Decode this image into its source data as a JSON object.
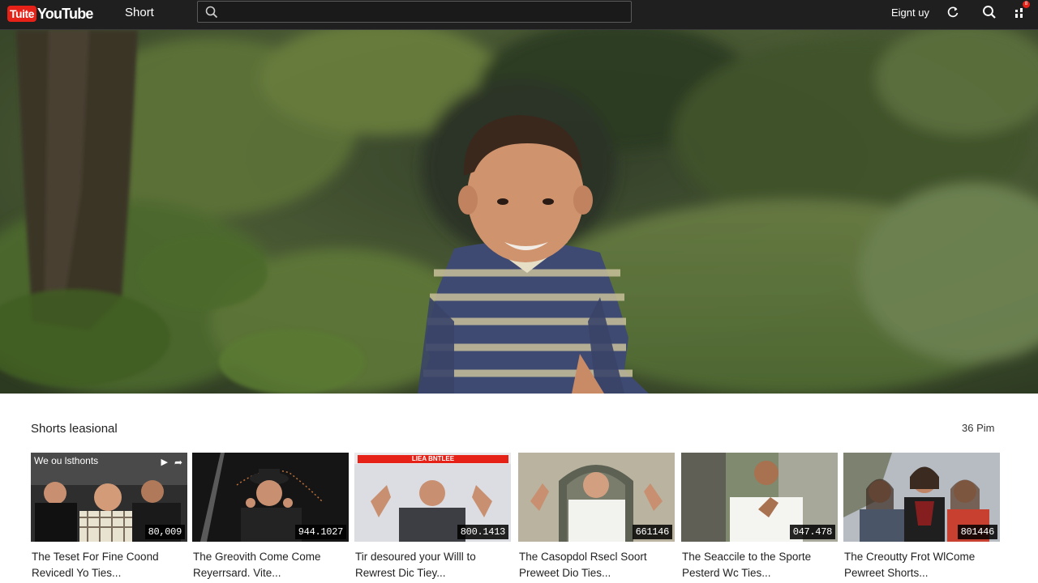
{
  "header": {
    "logo_box": "Tuite",
    "logo_text": "YouTube",
    "nav_label": "Short",
    "search_placeholder": "",
    "signup_label": "Eignt uy",
    "notification_count": "8",
    "icons": [
      "refresh-icon",
      "search-icon",
      "notifications-icon"
    ]
  },
  "shelf": {
    "title": "Shorts leasional",
    "meta": "36 Pim"
  },
  "shorts": [
    {
      "overlay": "We ou lsthonts",
      "duration": "80,009",
      "title_line1": "The Teset For Fine Coond",
      "title_line2": "Revicedl Yo Ties..."
    },
    {
      "duration": "944.1027",
      "title_line1": "The Greovith Come Come",
      "title_line2": "Reyerrsard. Vite..."
    },
    {
      "banner": "LIEA BNTLEE",
      "duration": "800.1413",
      "title_line1": "Tir desoured your Willl to",
      "title_line2": "Rewrest Dic Tiey..."
    },
    {
      "duration": "661146",
      "title_line1": "The Casopdol Rsecl Soort",
      "title_line2": "Preweet Dio Ties..."
    },
    {
      "duration": "047.478",
      "title_line1": "The Seaccile to the Sporte",
      "title_line2": "Pesterd Wc Ties..."
    },
    {
      "duration": "801446",
      "title_line1": "The Creoutty Frot WlCome",
      "title_line2": "Pewreet Shorts..."
    }
  ],
  "colors": {
    "brand_red": "#e62117",
    "topbar": "#1f1f1f"
  }
}
